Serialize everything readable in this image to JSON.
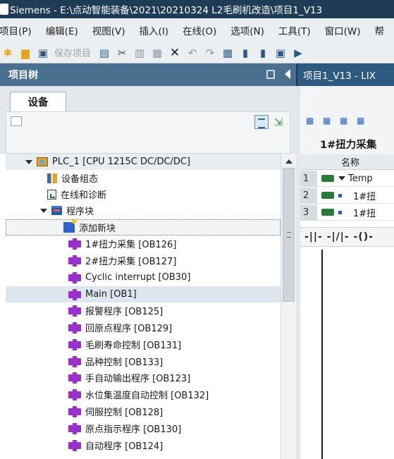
{
  "window": {
    "title": "Siemens  -  E:\\点动智能装备\\2021\\20210324 L2毛刷机改造\\项目1_V13"
  },
  "menu": [
    "项目(P)",
    "编辑(E)",
    "视图(V)",
    "插入(I)",
    "在线(O)",
    "选项(N)",
    "工具(T)",
    "窗口(W)",
    "帮"
  ],
  "toolbar": {
    "save_label": "保存项目"
  },
  "project_tree": {
    "title": "项目树",
    "devices_tab": "设备"
  },
  "editor_tab": {
    "label": "项目1_V13 - LIX"
  },
  "tree": [
    {
      "label": "PLC_1 [CPU 1215C DC/DC/DC]",
      "icon": "plc-icon",
      "level": 0,
      "expanded": true
    },
    {
      "label": "设备组态",
      "icon": "device-config-icon",
      "level": 1
    },
    {
      "label": "在线和诊断",
      "icon": "online-diagnostics-icon",
      "level": 1
    },
    {
      "label": "程序块",
      "icon": "program-blocks-folder-icon",
      "level": 1,
      "expanded": true
    },
    {
      "label": "添加新块",
      "icon": "add-new-block-icon",
      "level": 2,
      "selected": true
    },
    {
      "label": "1#扭力采集 [OB126]",
      "icon": "ob-block-icon",
      "level": 2
    },
    {
      "label": "2#扭力采集 [OB127]",
      "icon": "ob-block-icon",
      "level": 2
    },
    {
      "label": "Cyclic interrupt [OB30]",
      "icon": "ob-block-icon",
      "level": 2
    },
    {
      "label": "Main [OB1]",
      "icon": "ob-block-icon",
      "level": 2,
      "hover": true
    },
    {
      "label": "报警程序 [OB125]",
      "icon": "ob-block-icon",
      "level": 2
    },
    {
      "label": "回原点程序 [OB129]",
      "icon": "ob-block-icon",
      "level": 2
    },
    {
      "label": "毛刷寿命控制 [OB131]",
      "icon": "ob-block-icon",
      "level": 2
    },
    {
      "label": "品种控制 [OB133]",
      "icon": "ob-block-icon",
      "level": 2
    },
    {
      "label": "手自动输出程序 [OB123]",
      "icon": "ob-block-icon",
      "level": 2
    },
    {
      "label": "水位集温度自动控制 [OB132]",
      "icon": "ob-block-icon",
      "level": 2
    },
    {
      "label": "伺服控制 [OB128]",
      "icon": "ob-block-icon",
      "level": 2
    },
    {
      "label": "原点指示程序 [OB130]",
      "icon": "ob-block-icon",
      "level": 2
    },
    {
      "label": "自动程序 [OB124]",
      "icon": "ob-block-icon",
      "level": 2
    }
  ],
  "block_editor": {
    "block_title": "1#扭力采集",
    "column_name": "名称",
    "rows": [
      {
        "num": "1",
        "name": "Temp"
      },
      {
        "num": "2",
        "name": "1#扭"
      },
      {
        "num": "3",
        "name": "1#扭"
      }
    ],
    "ladder_symbols": "-||- -|/|- -()-"
  }
}
